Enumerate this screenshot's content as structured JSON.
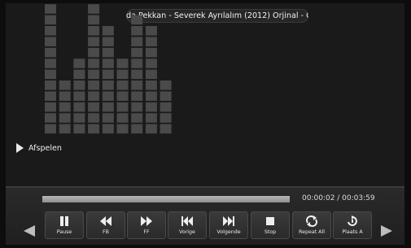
{
  "track": {
    "title": "da Pekkan - Severek Ayrılalım (2012) Orjinal - Or"
  },
  "status": {
    "label": "Afspelen",
    "icon": "play-icon"
  },
  "equalizer": {
    "levels": [
      14,
      5,
      7,
      12,
      10,
      7,
      11,
      10,
      5
    ],
    "colors": {
      "lit": "#4a4a4a"
    }
  },
  "playback": {
    "progress": 1.0,
    "time": "00:00:02 / 00:03:59"
  },
  "controls": [
    {
      "id": "pause",
      "label": "Pause",
      "icon": "pause-icon",
      "active": true
    },
    {
      "id": "fb",
      "label": "FB",
      "icon": "rewind-icon",
      "active": false
    },
    {
      "id": "ff",
      "label": "FF",
      "icon": "fast-forward-icon",
      "active": false
    },
    {
      "id": "prev",
      "label": "Vorige",
      "icon": "previous-icon",
      "active": false
    },
    {
      "id": "next",
      "label": "Volgende",
      "icon": "next-icon",
      "active": false
    },
    {
      "id": "stop",
      "label": "Stop",
      "icon": "stop-icon",
      "active": false
    },
    {
      "id": "repeat",
      "label": "Repeat All",
      "icon": "repeat-icon",
      "active": false
    },
    {
      "id": "place",
      "label": "Plaats A",
      "icon": "ab-repeat-icon",
      "active": false
    }
  ],
  "nav": {
    "left_icon": "arrow-left-icon",
    "right_icon": "arrow-right-icon"
  }
}
